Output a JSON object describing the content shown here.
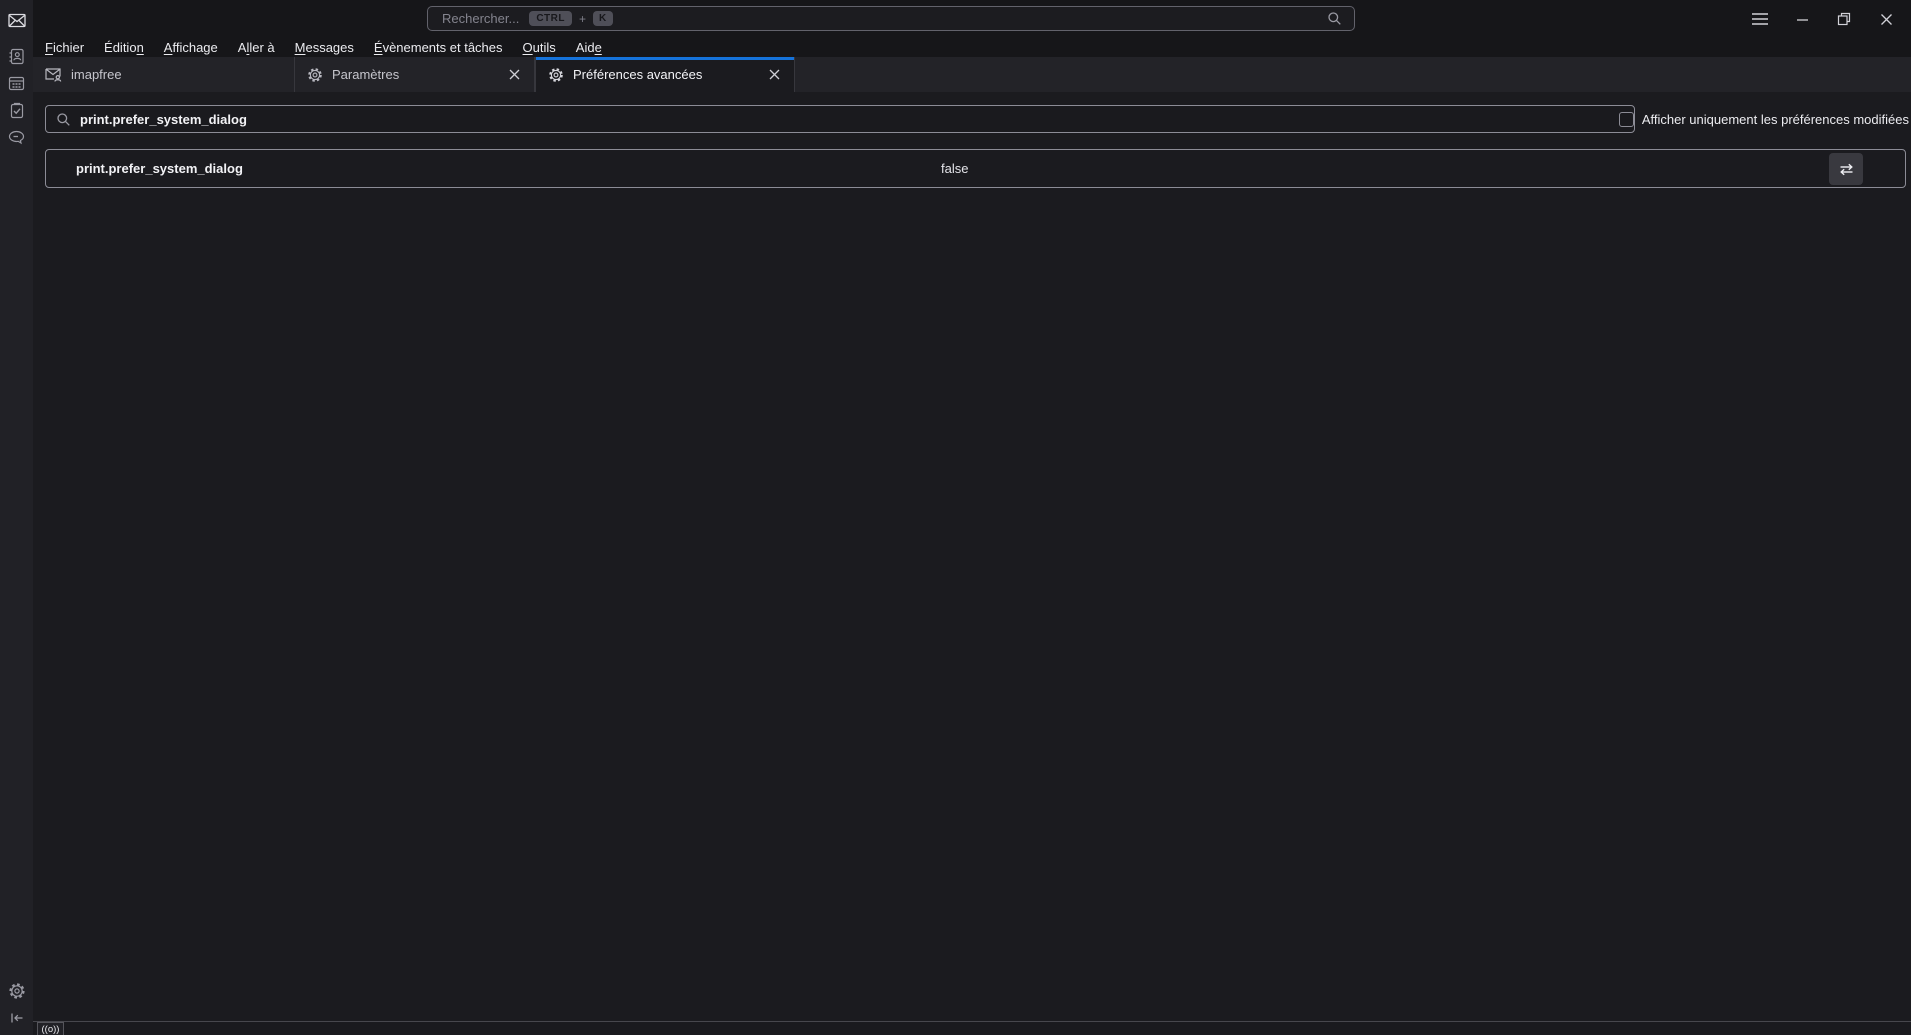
{
  "colors": {
    "accent_blue": "#1573db",
    "border_light": "#8c8c96"
  },
  "titlebar": {
    "search_placeholder": "Rechercher...",
    "shortcut": {
      "ctrl": "CTRL",
      "plus": "+",
      "key": "K"
    }
  },
  "menubar": {
    "items": [
      {
        "pre": "",
        "key": "F",
        "post": "ichier"
      },
      {
        "pre": "Éditio",
        "key": "n",
        "post": ""
      },
      {
        "pre": "",
        "key": "A",
        "post": "ffichage"
      },
      {
        "pre": "A",
        "key": "l",
        "post": "ler à"
      },
      {
        "pre": "",
        "key": "M",
        "post": "essages"
      },
      {
        "pre": "",
        "key": "É",
        "post": "vènements et tâches"
      },
      {
        "pre": "",
        "key": "O",
        "post": "utils"
      },
      {
        "pre": "Aid",
        "key": "e",
        "post": ""
      }
    ]
  },
  "tabs": [
    {
      "label": "imapfree",
      "icon": "mail-account-icon",
      "active": false,
      "closable": false
    },
    {
      "label": "Paramètres",
      "icon": "gear-icon",
      "active": false,
      "closable": true
    },
    {
      "label": "Préférences avancées",
      "icon": "gear-icon",
      "active": true,
      "closable": true
    }
  ],
  "config_editor": {
    "search_value": "print.prefer_system_dialog",
    "filter_checkbox_label": "Afficher uniquement les préférences modifiées",
    "filter_checked": false,
    "rows": [
      {
        "name": "print.prefer_system_dialog",
        "value": "false",
        "action_icon": "toggle-arrows-icon"
      }
    ]
  },
  "statusbar": {
    "badge": "((o))"
  }
}
